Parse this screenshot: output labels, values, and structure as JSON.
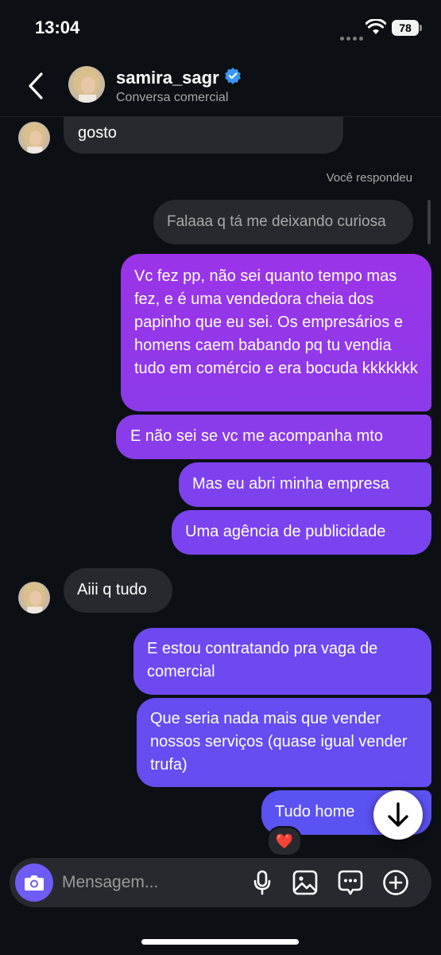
{
  "status_bar": {
    "time": "13:04",
    "battery": "78"
  },
  "header": {
    "username": "samira_sagr",
    "subtitle": "Conversa comercial",
    "verified": true
  },
  "thread": {
    "reply_label": "Você respondeu",
    "reply_quote": "Falaaa q tá me deixando curiosa",
    "messages": [
      {
        "from": "them",
        "text": "gosto"
      },
      {
        "from": "me",
        "text": "Vc fez pp, não sei quanto tempo mas fez, e é uma vendedora cheia dos papinho que eu sei. Os empresários e homens caem babando pq tu vendia tudo em comércio e era bocuda kkkkkkk"
      },
      {
        "from": "me",
        "text": "E não sei se vc me acompanha mto"
      },
      {
        "from": "me",
        "text": "Mas eu abri minha empresa"
      },
      {
        "from": "me",
        "text": "Uma agência de publicidade"
      },
      {
        "from": "them",
        "text": "Aiii q tudo"
      },
      {
        "from": "me",
        "text": "E estou contratando pra vaga de comercial"
      },
      {
        "from": "me",
        "text": "Que seria nada mais que vender nossos serviços (quase igual vender trufa)"
      },
      {
        "from": "me",
        "text": "Tudo home"
      }
    ],
    "reaction": "❤️"
  },
  "composer": {
    "placeholder": "Mensagem...",
    "value": ""
  },
  "icons": {
    "camera": "camera-icon",
    "mic": "microphone-icon",
    "gallery": "gallery-icon",
    "sticker": "sticker-icon",
    "plus": "add-icon",
    "scroll": "arrow-down-icon",
    "back": "back-chevron-icon"
  },
  "colors": {
    "background": "#0c1014",
    "incoming_bubble": "#262a2f",
    "outgoing_top": "#9b34e8",
    "outgoing_bottom": "#5b52f2",
    "accent": "#6e5cf4",
    "verified": "#3897f0"
  }
}
